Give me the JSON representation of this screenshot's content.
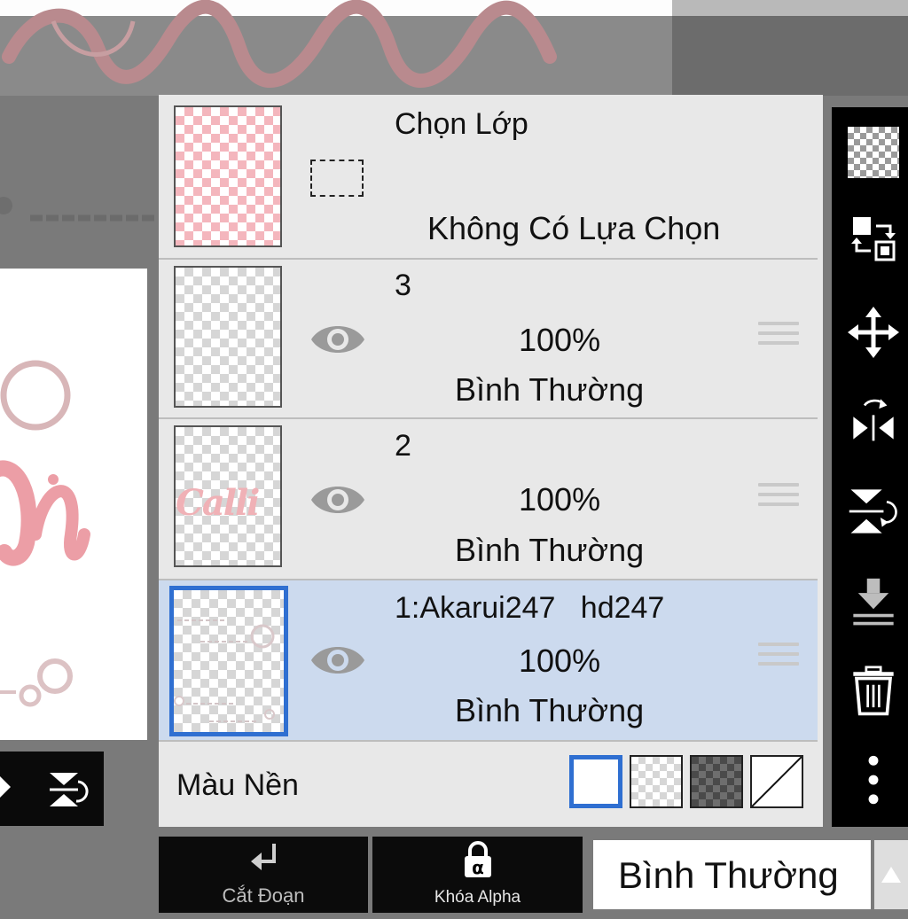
{
  "layers_panel": {
    "selection_row": {
      "title": "Chọn Lớp",
      "status": "Không Có Lựa Chọn"
    },
    "layers": [
      {
        "name": "3",
        "opacity": "100%",
        "blend": "Bình Thường",
        "visible": true,
        "selected": false
      },
      {
        "name": "2",
        "opacity": "100%",
        "blend": "Bình Thường",
        "visible": true,
        "selected": false,
        "thumb_text": "Calli"
      },
      {
        "name": "1:Akarui247   hd247",
        "opacity": "100%",
        "blend": "Bình Thường",
        "visible": true,
        "selected": true
      }
    ],
    "background": {
      "label": "Màu Nền",
      "options": [
        "white",
        "transparent-light",
        "transparent-dark",
        "none"
      ],
      "selected": "white"
    }
  },
  "bottom_bar": {
    "clip_label": "Cắt Đoạn",
    "alpha_lock_label": "Khóa Alpha",
    "alpha_glyph": "α",
    "blend_mode_value": "Bình Thường"
  },
  "right_toolbar": {
    "icons": [
      "checker-icon",
      "swap-layer-icon",
      "move-icon",
      "flip-horizontal-icon",
      "flip-vertical-icon",
      "merge-down-icon",
      "trash-icon",
      "more-icon"
    ]
  },
  "colors": {
    "accent": "#2f6fd1",
    "selected_row": "#ccdaee",
    "panel": "#e8e8e8",
    "toolbar": "#000000",
    "script_pink": "#e8a3a8"
  }
}
